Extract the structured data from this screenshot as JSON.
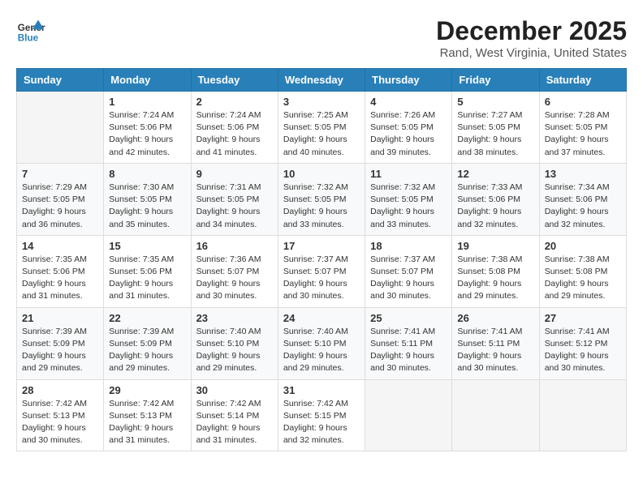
{
  "logo": {
    "general": "General",
    "blue": "Blue"
  },
  "title": "December 2025",
  "location": "Rand, West Virginia, United States",
  "days_header": [
    "Sunday",
    "Monday",
    "Tuesday",
    "Wednesday",
    "Thursday",
    "Friday",
    "Saturday"
  ],
  "weeks": [
    [
      {
        "day": "",
        "info": ""
      },
      {
        "day": "1",
        "info": "Sunrise: 7:24 AM\nSunset: 5:06 PM\nDaylight: 9 hours\nand 42 minutes."
      },
      {
        "day": "2",
        "info": "Sunrise: 7:24 AM\nSunset: 5:06 PM\nDaylight: 9 hours\nand 41 minutes."
      },
      {
        "day": "3",
        "info": "Sunrise: 7:25 AM\nSunset: 5:05 PM\nDaylight: 9 hours\nand 40 minutes."
      },
      {
        "day": "4",
        "info": "Sunrise: 7:26 AM\nSunset: 5:05 PM\nDaylight: 9 hours\nand 39 minutes."
      },
      {
        "day": "5",
        "info": "Sunrise: 7:27 AM\nSunset: 5:05 PM\nDaylight: 9 hours\nand 38 minutes."
      },
      {
        "day": "6",
        "info": "Sunrise: 7:28 AM\nSunset: 5:05 PM\nDaylight: 9 hours\nand 37 minutes."
      }
    ],
    [
      {
        "day": "7",
        "info": "Sunrise: 7:29 AM\nSunset: 5:05 PM\nDaylight: 9 hours\nand 36 minutes."
      },
      {
        "day": "8",
        "info": "Sunrise: 7:30 AM\nSunset: 5:05 PM\nDaylight: 9 hours\nand 35 minutes."
      },
      {
        "day": "9",
        "info": "Sunrise: 7:31 AM\nSunset: 5:05 PM\nDaylight: 9 hours\nand 34 minutes."
      },
      {
        "day": "10",
        "info": "Sunrise: 7:32 AM\nSunset: 5:05 PM\nDaylight: 9 hours\nand 33 minutes."
      },
      {
        "day": "11",
        "info": "Sunrise: 7:32 AM\nSunset: 5:05 PM\nDaylight: 9 hours\nand 33 minutes."
      },
      {
        "day": "12",
        "info": "Sunrise: 7:33 AM\nSunset: 5:06 PM\nDaylight: 9 hours\nand 32 minutes."
      },
      {
        "day": "13",
        "info": "Sunrise: 7:34 AM\nSunset: 5:06 PM\nDaylight: 9 hours\nand 32 minutes."
      }
    ],
    [
      {
        "day": "14",
        "info": "Sunrise: 7:35 AM\nSunset: 5:06 PM\nDaylight: 9 hours\nand 31 minutes."
      },
      {
        "day": "15",
        "info": "Sunrise: 7:35 AM\nSunset: 5:06 PM\nDaylight: 9 hours\nand 31 minutes."
      },
      {
        "day": "16",
        "info": "Sunrise: 7:36 AM\nSunset: 5:07 PM\nDaylight: 9 hours\nand 30 minutes."
      },
      {
        "day": "17",
        "info": "Sunrise: 7:37 AM\nSunset: 5:07 PM\nDaylight: 9 hours\nand 30 minutes."
      },
      {
        "day": "18",
        "info": "Sunrise: 7:37 AM\nSunset: 5:07 PM\nDaylight: 9 hours\nand 30 minutes."
      },
      {
        "day": "19",
        "info": "Sunrise: 7:38 AM\nSunset: 5:08 PM\nDaylight: 9 hours\nand 29 minutes."
      },
      {
        "day": "20",
        "info": "Sunrise: 7:38 AM\nSunset: 5:08 PM\nDaylight: 9 hours\nand 29 minutes."
      }
    ],
    [
      {
        "day": "21",
        "info": "Sunrise: 7:39 AM\nSunset: 5:09 PM\nDaylight: 9 hours\nand 29 minutes."
      },
      {
        "day": "22",
        "info": "Sunrise: 7:39 AM\nSunset: 5:09 PM\nDaylight: 9 hours\nand 29 minutes."
      },
      {
        "day": "23",
        "info": "Sunrise: 7:40 AM\nSunset: 5:10 PM\nDaylight: 9 hours\nand 29 minutes."
      },
      {
        "day": "24",
        "info": "Sunrise: 7:40 AM\nSunset: 5:10 PM\nDaylight: 9 hours\nand 29 minutes."
      },
      {
        "day": "25",
        "info": "Sunrise: 7:41 AM\nSunset: 5:11 PM\nDaylight: 9 hours\nand 30 minutes."
      },
      {
        "day": "26",
        "info": "Sunrise: 7:41 AM\nSunset: 5:11 PM\nDaylight: 9 hours\nand 30 minutes."
      },
      {
        "day": "27",
        "info": "Sunrise: 7:41 AM\nSunset: 5:12 PM\nDaylight: 9 hours\nand 30 minutes."
      }
    ],
    [
      {
        "day": "28",
        "info": "Sunrise: 7:42 AM\nSunset: 5:13 PM\nDaylight: 9 hours\nand 30 minutes."
      },
      {
        "day": "29",
        "info": "Sunrise: 7:42 AM\nSunset: 5:13 PM\nDaylight: 9 hours\nand 31 minutes."
      },
      {
        "day": "30",
        "info": "Sunrise: 7:42 AM\nSunset: 5:14 PM\nDaylight: 9 hours\nand 31 minutes."
      },
      {
        "day": "31",
        "info": "Sunrise: 7:42 AM\nSunset: 5:15 PM\nDaylight: 9 hours\nand 32 minutes."
      },
      {
        "day": "",
        "info": ""
      },
      {
        "day": "",
        "info": ""
      },
      {
        "day": "",
        "info": ""
      }
    ]
  ]
}
